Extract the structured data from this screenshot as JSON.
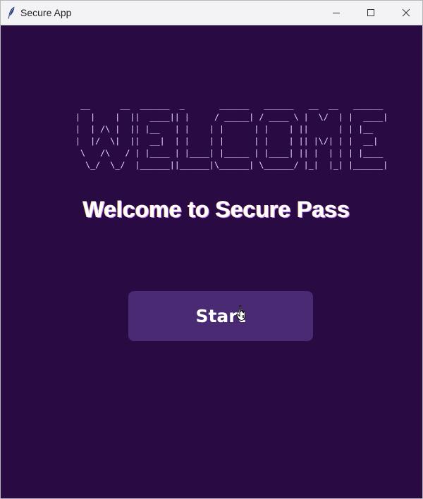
{
  "window": {
    "title": "Secure App",
    "icon": "feather-icon",
    "controls": [
      "minimize-icon",
      "maximize-icon",
      "close-icon"
    ]
  },
  "main": {
    "ascii_art": " __      __  ______  _       ______   ______   __  __   ______ \n|  |    |  ||  ____|| |     / _____| / ____ \\ |  \\/  | |  ____|\n|  | /\\ |  || |__   | |    | |      | |    | ||      | | |__   \n|  |/  \\|  ||  __|  | |    | |      | |    | || |\\/| | |  __|  \n \\   /\\   / | |____ | |____| |_____ | |____| || |  | | | |____ \n  \\_/  \\_/  |______||______|\\______| \\______/ |_|  |_| |______|",
    "heading": "Welcome to Secure Pass",
    "start_button_label": "Start"
  },
  "colors": {
    "background": "#2a0a43",
    "button": "#4a2a72",
    "text": "#ffffff",
    "titlebar": "#f3f2f4"
  }
}
